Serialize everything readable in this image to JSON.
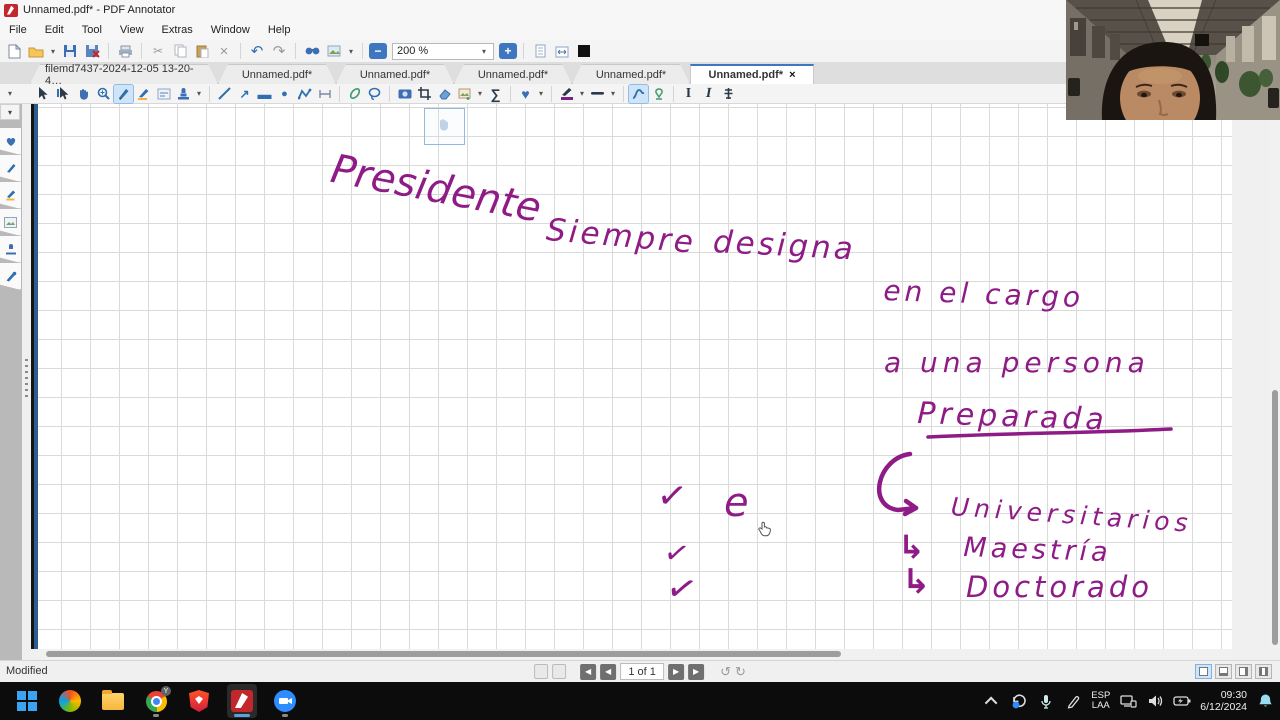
{
  "window": {
    "title": "Unnamed.pdf* - PDF Annotator"
  },
  "menu": {
    "items": [
      "File",
      "Edit",
      "Tool",
      "View",
      "Extras",
      "Window",
      "Help"
    ]
  },
  "main_toolbar": {
    "zoom_value": "200 %"
  },
  "tab_bar": {
    "tabs": [
      {
        "label": "filemd7437-2024-12-05 13-20-4…"
      },
      {
        "label": "Unnamed.pdf*"
      },
      {
        "label": "Unnamed.pdf*"
      },
      {
        "label": "Unnamed.pdf*"
      },
      {
        "label": "Unnamed.pdf*"
      },
      {
        "label": "Unnamed.pdf*"
      }
    ],
    "close_glyph": "×"
  },
  "glyphs": {
    "dropdown": "▾",
    "scissors": "✂",
    "delete": "×",
    "undo": "↶",
    "redo": "↷",
    "sigma": "∑",
    "heart": "♥",
    "arrow_ne": "↗",
    "rect": "▬",
    "dot": "●",
    "check": "✓",
    "hook_arrow": "↳",
    "prev": "◀",
    "next": "▶",
    "back": "↺",
    "forward": "↻",
    "text_i": "I",
    "pen": "✎",
    "minus": "−",
    "plus": "+"
  },
  "annotations": {
    "ink_color": "#8e1b86",
    "words": {
      "presidente": "Presidente",
      "siempre": "Siempre",
      "designa": "designa",
      "en_el_cargo": "en el cargo",
      "a_una_persona": "a una persona",
      "preparada": "Preparada",
      "e_glyph": "e",
      "universitarios": "Universitarios",
      "maestria": "Maestría",
      "doctorado": "Doctorado"
    }
  },
  "status_bar": {
    "modified": "Modified",
    "page_indicator": "1 of 1"
  },
  "taskbar": {
    "chrome_badge": "Y",
    "tray": {
      "language_line1": "ESP",
      "language_line2": "LAA",
      "time": "09:30",
      "date": "6/12/2024"
    }
  }
}
